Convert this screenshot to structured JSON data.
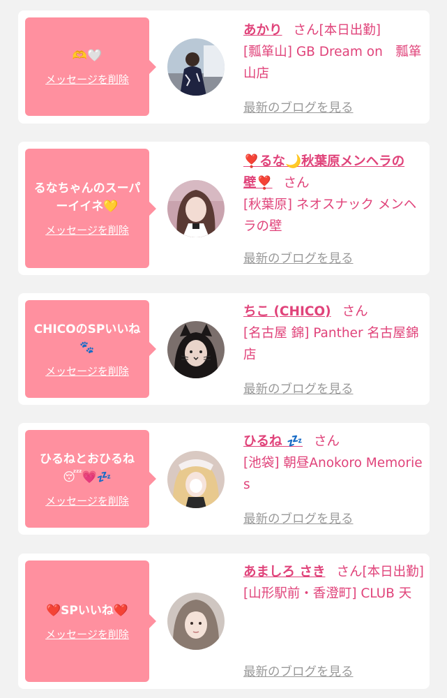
{
  "colors": {
    "page_bg": "#f2f2f2",
    "card_bg": "#ffffff",
    "bubble_bg": "#ff909f",
    "accent": "#e0437a",
    "link_gray": "#9a9a9a"
  },
  "messages": [
    {
      "bubble_text": "🫶🤍",
      "delete_label": "メッセージを削除",
      "avatar_icon": "girl-kimono-avatar",
      "name": "あかり",
      "san": "さん[本日出勤]",
      "shop": "[瓢箪山] GB Dream on　瓢箪山店",
      "blog_label": "最新のブログを見る"
    },
    {
      "bubble_text": "るなちゃんのスーパーイイネ💛",
      "delete_label": "メッセージを削除",
      "avatar_icon": "girl-selfie-avatar",
      "name": "❣️るな🌙秋葉原メンヘラの壁❣️",
      "san": "さん",
      "shop": "[秋葉原] ネオスナック メンヘラの壁",
      "blog_label": "最新のブログを見る"
    },
    {
      "bubble_text": "CHICOのSPいいね🐾",
      "delete_label": "メッセージを削除",
      "avatar_icon": "cat-filter-avatar",
      "name": "ちこ (CHICO)",
      "san": "さん",
      "shop": "[名古屋 錦] Panther 名古屋錦店",
      "blog_label": "最新のブログを見る"
    },
    {
      "bubble_text": "ひるねとおひるね😴💗💤",
      "delete_label": "メッセージを削除",
      "avatar_icon": "blonde-girl-avatar",
      "name": "ひるね 💤",
      "san": "さん",
      "shop": "[池袋] 朝昼Anokoro Memories",
      "blog_label": "最新のブログを見る"
    },
    {
      "bubble_text": "❤️SPいいね❤️",
      "delete_label": "メッセージを削除",
      "avatar_icon": "girl-bangs-avatar",
      "name": "あましろ さき",
      "san": "さん[本日出勤]",
      "shop": "[山形駅前・香澄町] CLUB 天",
      "blog_label": "最新のブログを見る"
    }
  ]
}
